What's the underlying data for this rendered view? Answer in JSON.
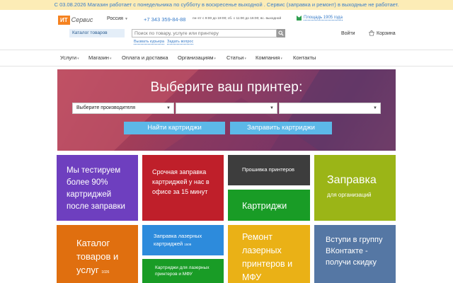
{
  "notice": "С 03.08.2026 Магазин работает с понедельника по субботу в воскресенье выходной . Сервис (заправка и ремонт) в выходные не работает.",
  "header": {
    "logo_box": "ИТ",
    "logo_text": "Сервис",
    "region": "Россия",
    "phone": "+7 343 359-84-88",
    "hours": "пн–пт с 9:00 до 19:00; сб. с 11:00 до 16:00; вс. выходной",
    "address": "Площадь 1905 года",
    "catalog_button": "Каталог товаров",
    "search_placeholder": "Поиск по товару, услуге или принтеру",
    "call_courier": "Вызвать курьера",
    "ask_question": "Задать вопрос",
    "login": "Войти",
    "cart": "Корзина"
  },
  "nav": [
    "Услуги",
    "Магазин",
    "Оплата и доставка",
    "Организациям",
    "Статьи",
    "Компания",
    "Контакты"
  ],
  "hero": {
    "title": "Выберите ваш принтер:",
    "select_manufacturer": "Выберите производителя",
    "find_button": "Найти картриджи",
    "refill_button": "Заправить картриджи"
  },
  "tiles": {
    "tested": "Мы тестируем более 90% картриджей после заправки",
    "urgent_refill": "Срочная заправка картриджей у нас в офисе за 15 минут",
    "firmware": "Прошивка принтеров",
    "cartridges": "Картриджи",
    "refill_org": "Заправка",
    "refill_org_sub": "для организаций",
    "catalog": "Каталог товаров и услуг",
    "catalog_count": "1026",
    "laser_refill": "Заправка лазерных картриджей",
    "laser_refill_count": "1509",
    "mfu_cartridges": "Картриджи для лазерных принтеров и МФУ",
    "repair": "Ремонт лазерных принтеров и МФУ",
    "vk": "Вступи в группу ВКонтакте - получи скидку"
  },
  "colors": {
    "notice_bg": "#fcecb6",
    "link": "#3a7dc9",
    "logo": "#f58220",
    "hero_button": "#5cb8e8",
    "tile_purple": "#6e3fbf",
    "tile_red": "#bf1f2a",
    "tile_dark": "#3d3d3d",
    "tile_green": "#199c26",
    "tile_olive": "#9bb517",
    "tile_orange": "#e06f0f",
    "tile_blue": "#2d8bdc",
    "tile_yellow": "#eab116",
    "tile_steel": "#5577a4"
  }
}
